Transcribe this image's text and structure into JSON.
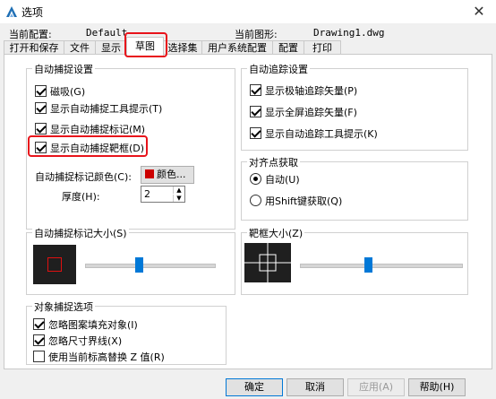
{
  "window": {
    "title": "选项",
    "close_label": "✕"
  },
  "header": {
    "current_profile_label": "当前配置:",
    "current_profile_value": "Default",
    "current_drawing_label": "当前图形:",
    "current_drawing_value": "Drawing1.dwg"
  },
  "tabs": [
    {
      "label": "打开和保存"
    },
    {
      "label": "文件"
    },
    {
      "label": "显示"
    },
    {
      "label": "草图"
    },
    {
      "label": "选择集"
    },
    {
      "label": "用户系统配置"
    },
    {
      "label": "配置"
    },
    {
      "label": "打印"
    }
  ],
  "autosnap": {
    "title": "自动捕捉设置",
    "options": [
      {
        "label": "磁吸(G)",
        "checked": true
      },
      {
        "label": "显示自动捕捉工具提示(T)",
        "checked": true
      },
      {
        "label": "显示自动捕捉标记(M)",
        "checked": true
      },
      {
        "label": "显示自动捕捉靶框(D)",
        "checked": true
      }
    ],
    "color_label": "自动捕捉标记颜色(C):",
    "color_button": "颜色...",
    "thickness_label": "厚度(H):",
    "thickness_value": "2"
  },
  "autotrack": {
    "title": "自动追踪设置",
    "options": [
      {
        "label": "显示极轴追踪矢量(P)",
        "checked": true
      },
      {
        "label": "显示全屏追踪矢量(F)",
        "checked": true
      },
      {
        "label": "显示自动追踪工具提示(K)",
        "checked": true
      }
    ]
  },
  "alignment": {
    "title": "对齐点获取",
    "options": [
      {
        "label": "自动(U)",
        "selected": true
      },
      {
        "label": "用Shift键获取(Q)",
        "selected": false
      }
    ]
  },
  "marker_size": {
    "title": "自动捕捉标记大小(S)",
    "level": 0.42
  },
  "aperture_size": {
    "title": "靶框大小(Z)",
    "level": 0.42
  },
  "object_snap": {
    "title": "对象捕捉选项",
    "options": [
      {
        "label": "忽略图案填充对象(I)",
        "checked": true
      },
      {
        "label": "忽略尺寸界线(X)",
        "checked": true
      },
      {
        "label": "使用当前标高替换 Z 值(R)",
        "checked": false
      }
    ]
  },
  "buttons": {
    "ok": "确定",
    "cancel": "取消",
    "apply": "应用(A)",
    "help": "帮助(H)"
  },
  "colors": {
    "highlight": "#e8141b",
    "marker_color": "#cc0000",
    "accent": "#0078d7"
  }
}
